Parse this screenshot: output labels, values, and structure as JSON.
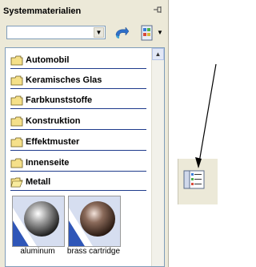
{
  "panel": {
    "title": "Systemmaterialien",
    "pin_icon": "pin-icon",
    "search": {
      "value": "",
      "placeholder": ""
    },
    "folders": [
      {
        "label": "Automobil",
        "open": false
      },
      {
        "label": "Keramisches Glas",
        "open": false
      },
      {
        "label": "Farbkunststoffe",
        "open": false
      },
      {
        "label": "Konstruktion",
        "open": false
      },
      {
        "label": "Effektmuster",
        "open": false
      },
      {
        "label": "Innenseite",
        "open": false
      },
      {
        "label": "Metall",
        "open": true
      }
    ],
    "materials": [
      {
        "label": "aluminum",
        "color": "#9a9a9a"
      },
      {
        "label": "brass cartridge",
        "color": "#8a6a5a"
      }
    ]
  },
  "colors": {
    "panel_bg": "#ece9d8",
    "separator": "#1f3b8c",
    "folder_fill": "#f5e08a"
  }
}
